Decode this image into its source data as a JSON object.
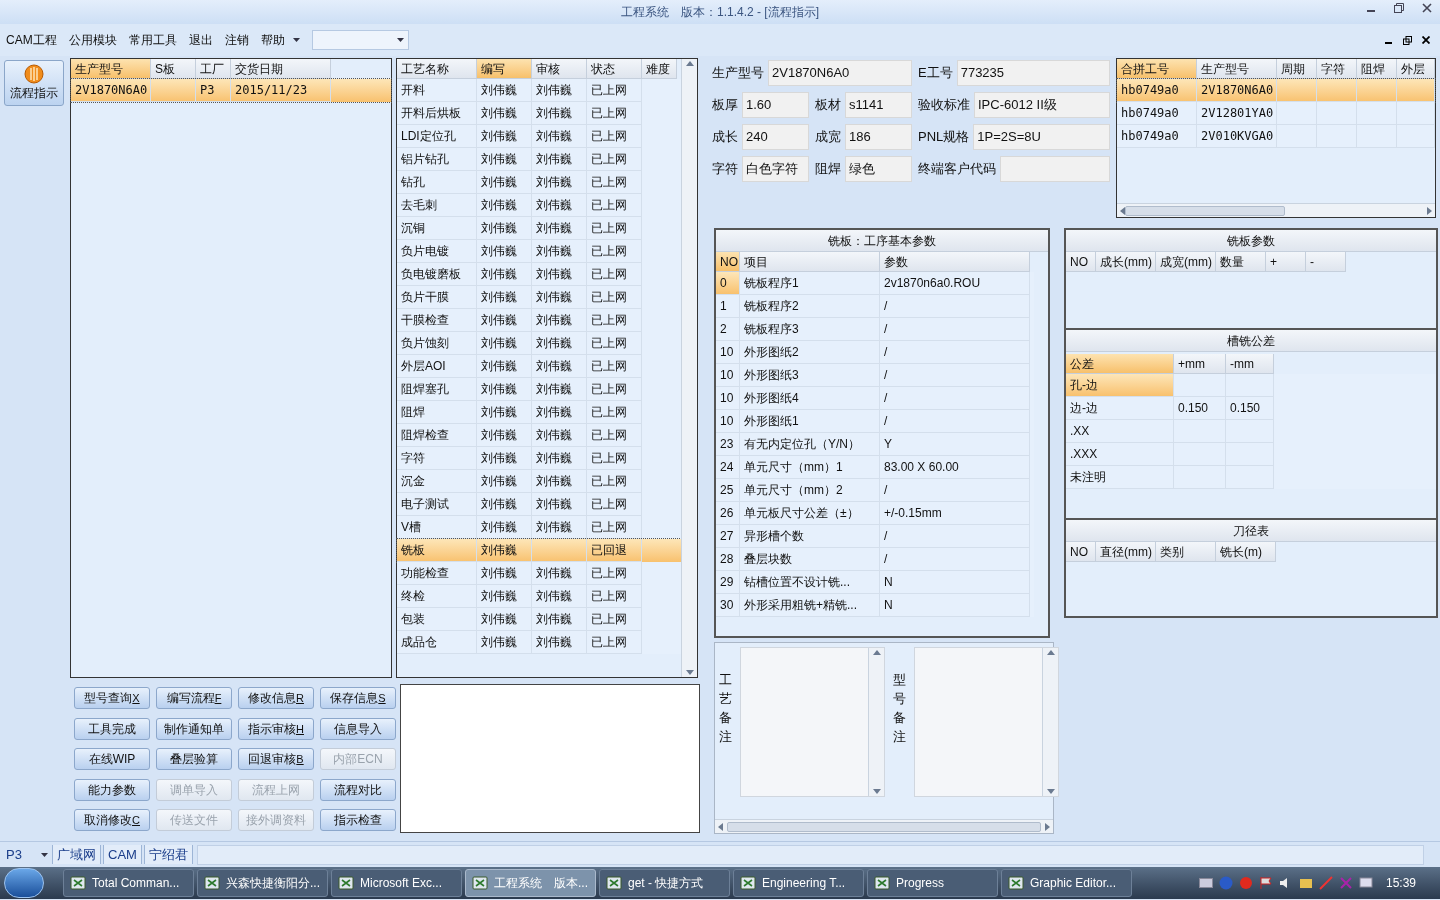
{
  "window": {
    "title": "工程系统",
    "version": "版本：1.1.4.2 - [流程指示]"
  },
  "menu": {
    "items": [
      "CAM工程",
      "公用模块",
      "常用工具",
      "退出",
      "注销",
      "帮助"
    ]
  },
  "sidebar": {
    "button": "流程指示",
    "selected": true
  },
  "orders": {
    "columns": [
      "生产型号",
      "S板",
      "工厂",
      "交货日期"
    ],
    "rows": [
      {
        "cells": [
          "2V1870N6A0",
          "",
          "P3",
          "2015/11/23"
        ],
        "selected": true
      }
    ]
  },
  "process": {
    "columns": [
      "工艺名称",
      "编写",
      "审核",
      "状态",
      "难度"
    ],
    "rows": [
      {
        "cells": [
          "开料",
          "刘伟巍",
          "刘伟巍",
          "已上网"
        ],
        "selected": false
      },
      {
        "cells": [
          "开料后烘板",
          "刘伟巍",
          "刘伟巍",
          "已上网"
        ],
        "selected": false
      },
      {
        "cells": [
          "LDI定位孔",
          "刘伟巍",
          "刘伟巍",
          "已上网"
        ],
        "selected": false
      },
      {
        "cells": [
          "铝片钻孔",
          "刘伟巍",
          "刘伟巍",
          "已上网"
        ],
        "selected": false
      },
      {
        "cells": [
          "钻孔",
          "刘伟巍",
          "刘伟巍",
          "已上网"
        ],
        "selected": false
      },
      {
        "cells": [
          "去毛刺",
          "刘伟巍",
          "刘伟巍",
          "已上网"
        ],
        "selected": false
      },
      {
        "cells": [
          "沉铜",
          "刘伟巍",
          "刘伟巍",
          "已上网"
        ],
        "selected": false
      },
      {
        "cells": [
          "负片电镀",
          "刘伟巍",
          "刘伟巍",
          "已上网"
        ],
        "selected": false
      },
      {
        "cells": [
          "负电镀磨板",
          "刘伟巍",
          "刘伟巍",
          "已上网"
        ],
        "selected": false
      },
      {
        "cells": [
          "负片干膜",
          "刘伟巍",
          "刘伟巍",
          "已上网"
        ],
        "selected": false
      },
      {
        "cells": [
          "干膜检查",
          "刘伟巍",
          "刘伟巍",
          "已上网"
        ],
        "selected": false
      },
      {
        "cells": [
          "负片蚀刻",
          "刘伟巍",
          "刘伟巍",
          "已上网"
        ],
        "selected": false
      },
      {
        "cells": [
          "外层AOI",
          "刘伟巍",
          "刘伟巍",
          "已上网"
        ],
        "selected": false
      },
      {
        "cells": [
          "阻焊塞孔",
          "刘伟巍",
          "刘伟巍",
          "已上网"
        ],
        "selected": false
      },
      {
        "cells": [
          "阻焊",
          "刘伟巍",
          "刘伟巍",
          "已上网"
        ],
        "selected": false
      },
      {
        "cells": [
          "阻焊检查",
          "刘伟巍",
          "刘伟巍",
          "已上网"
        ],
        "selected": false
      },
      {
        "cells": [
          "字符",
          "刘伟巍",
          "刘伟巍",
          "已上网"
        ],
        "selected": false
      },
      {
        "cells": [
          "沉金",
          "刘伟巍",
          "刘伟巍",
          "已上网"
        ],
        "selected": false
      },
      {
        "cells": [
          "电子测试",
          "刘伟巍",
          "刘伟巍",
          "已上网"
        ],
        "selected": false
      },
      {
        "cells": [
          "V槽",
          "刘伟巍",
          "刘伟巍",
          "已上网"
        ],
        "selected": false
      },
      {
        "cells": [
          "铣板",
          "刘伟巍",
          "",
          "已回退"
        ],
        "selected": true
      },
      {
        "cells": [
          "功能检查",
          "刘伟巍",
          "刘伟巍",
          "已上网"
        ],
        "selected": false
      },
      {
        "cells": [
          "终检",
          "刘伟巍",
          "刘伟巍",
          "已上网"
        ],
        "selected": false
      },
      {
        "cells": [
          "包装",
          "刘伟巍",
          "刘伟巍",
          "已上网"
        ],
        "selected": false
      },
      {
        "cells": [
          "成品仓",
          "刘伟巍",
          "刘伟巍",
          "已上网"
        ],
        "selected": false
      }
    ]
  },
  "buttons": [
    {
      "label": "型号查询",
      "shortcut": "X",
      "disabled": false
    },
    {
      "label": "编写流程",
      "shortcut": "F",
      "disabled": false
    },
    {
      "label": "修改信息",
      "shortcut": "R",
      "disabled": false
    },
    {
      "label": "保存信息",
      "shortcut": "S",
      "disabled": false
    },
    {
      "label": "工具完成",
      "disabled": false
    },
    {
      "label": "制作通知单",
      "disabled": false
    },
    {
      "label": "指示审核",
      "shortcut": "H",
      "disabled": false
    },
    {
      "label": "信息导入",
      "disabled": false
    },
    {
      "label": "在线WIP",
      "disabled": false
    },
    {
      "label": "叠层验算",
      "disabled": false
    },
    {
      "label": "回退审核",
      "shortcut": "B",
      "disabled": false
    },
    {
      "label": "内部ECN",
      "disabled": true
    },
    {
      "label": "能力参数",
      "disabled": false
    },
    {
      "label": "调单导入",
      "disabled": true
    },
    {
      "label": "流程上网",
      "disabled": true
    },
    {
      "label": "流程对比",
      "disabled": false
    },
    {
      "label": "取消修改",
      "shortcut": "C",
      "disabled": false
    },
    {
      "label": "传送文件",
      "disabled": true
    },
    {
      "label": "接外调资料",
      "disabled": true
    },
    {
      "label": "指示检查",
      "disabled": false
    }
  ],
  "info": {
    "fields": [
      {
        "label": "生产型号",
        "value": "2V1870N6A0"
      },
      {
        "label": "E工号",
        "value": "773235"
      },
      {
        "label": "板厚",
        "value": "1.60"
      },
      {
        "label": "板材",
        "value": "s1141"
      },
      {
        "label": "验收标准",
        "value": "IPC-6012 II级"
      },
      {
        "label": "成长",
        "value": "240"
      },
      {
        "label": "成宽",
        "value": "186"
      },
      {
        "label": "PNL规格",
        "value": "1P=2S=8U"
      },
      {
        "label": "字符",
        "value": "白色字符"
      },
      {
        "label": "阻焊",
        "value": "绿色"
      },
      {
        "label": "终端客户代码"
      }
    ]
  },
  "merge": {
    "columns": [
      "合拼工号",
      "生产型号",
      "周期",
      "字符",
      "阻焊",
      "外层"
    ],
    "rows": [
      {
        "cells": [
          "hb0749a0",
          "2V1870N6A0",
          "",
          "",
          "",
          ""
        ],
        "selected": true
      },
      {
        "cells": [
          "hb0749a0",
          "2V12801YA0",
          "",
          "",
          "",
          ""
        ],
        "selected": false
      },
      {
        "cells": [
          "hb0749a0",
          "2V010KVGA0",
          "",
          "",
          "",
          ""
        ],
        "selected": false
      }
    ]
  },
  "milling": {
    "title": "铣板：工序基本参数",
    "columns": [
      "NO",
      "项目",
      "参数"
    ],
    "rows": [
      {
        "cells": [
          "0",
          "铣板程序1",
          "2v1870n6a0.ROU"
        ],
        "selected": true
      },
      {
        "cells": [
          "1",
          "铣板程序2",
          "/"
        ],
        "selected": false
      },
      {
        "cells": [
          "2",
          "铣板程序3",
          "/"
        ],
        "selected": false
      },
      {
        "cells": [
          "10",
          "外形图纸2",
          "/"
        ],
        "selected": false
      },
      {
        "cells": [
          "10",
          "外形图纸3",
          "/"
        ],
        "selected": false
      },
      {
        "cells": [
          "10",
          "外形图纸4",
          "/"
        ],
        "selected": false
      },
      {
        "cells": [
          "10",
          "外形图纸1",
          "/"
        ],
        "selected": false
      },
      {
        "cells": [
          "23",
          "有无内定位孔（Y/N）",
          "Y"
        ],
        "selected": false
      },
      {
        "cells": [
          "24",
          "单元尺寸（mm）1",
          "83.00 X 60.00"
        ],
        "selected": false
      },
      {
        "cells": [
          "25",
          "单元尺寸（mm）2",
          "/"
        ],
        "selected": false
      },
      {
        "cells": [
          "26",
          "单元板尺寸公差（±）",
          "+/-0.15mm"
        ],
        "selected": false
      },
      {
        "cells": [
          "27",
          "异形槽个数",
          "/"
        ],
        "selected": false
      },
      {
        "cells": [
          "28",
          "叠层块数",
          "/"
        ],
        "selected": false
      },
      {
        "cells": [
          "29",
          "钻槽位置不设计铣...",
          "N"
        ],
        "selected": false
      },
      {
        "cells": [
          "30",
          "外形采用粗铣+精铣...",
          "N"
        ],
        "selected": false
      }
    ]
  },
  "mill_params": {
    "title": "铣板参数",
    "columns": [
      "NO",
      "成长(mm)",
      "成宽(mm)",
      "数量",
      "+",
      "-"
    ]
  },
  "tolerance": {
    "title": "槽铣公差",
    "columns": [
      "公差",
      "+mm",
      "-mm"
    ],
    "rows": [
      {
        "cells": [
          "孔-边",
          "",
          ""
        ],
        "selected": true
      },
      {
        "cells": [
          "边-边",
          "0.150",
          "0.150"
        ],
        "selected": false
      },
      {
        "cells": [
          ".XX",
          "",
          ""
        ],
        "selected": false
      },
      {
        "cells": [
          ".XXX",
          "",
          ""
        ],
        "selected": false
      },
      {
        "cells": [
          "未注明",
          "",
          ""
        ],
        "selected": false
      }
    ]
  },
  "tools": {
    "title": "刀径表",
    "columns": [
      "NO",
      "直径(mm)",
      "类别",
      "铣长(m)"
    ]
  },
  "notes": [
    {
      "label": "工艺备注"
    },
    {
      "label": "型号备注"
    }
  ],
  "status_bar": {
    "factory": "P3",
    "items": [
      "广域网",
      "CAM",
      "宁绍君"
    ]
  },
  "taskbar": {
    "items": [
      {
        "label": "Total Comman...",
        "active": false
      },
      {
        "label": "兴森快捷衡阳分...",
        "active": false
      },
      {
        "label": "Microsoft Exc...",
        "active": false
      },
      {
        "label": "工程系统　版本...",
        "active": true
      },
      {
        "label": "get - 快捷方式",
        "active": false
      },
      {
        "label": "Engineering T...",
        "active": false
      },
      {
        "label": "Progress",
        "active": false
      },
      {
        "label": "Graphic Editor...",
        "active": false
      }
    ],
    "clock": "15:39"
  }
}
